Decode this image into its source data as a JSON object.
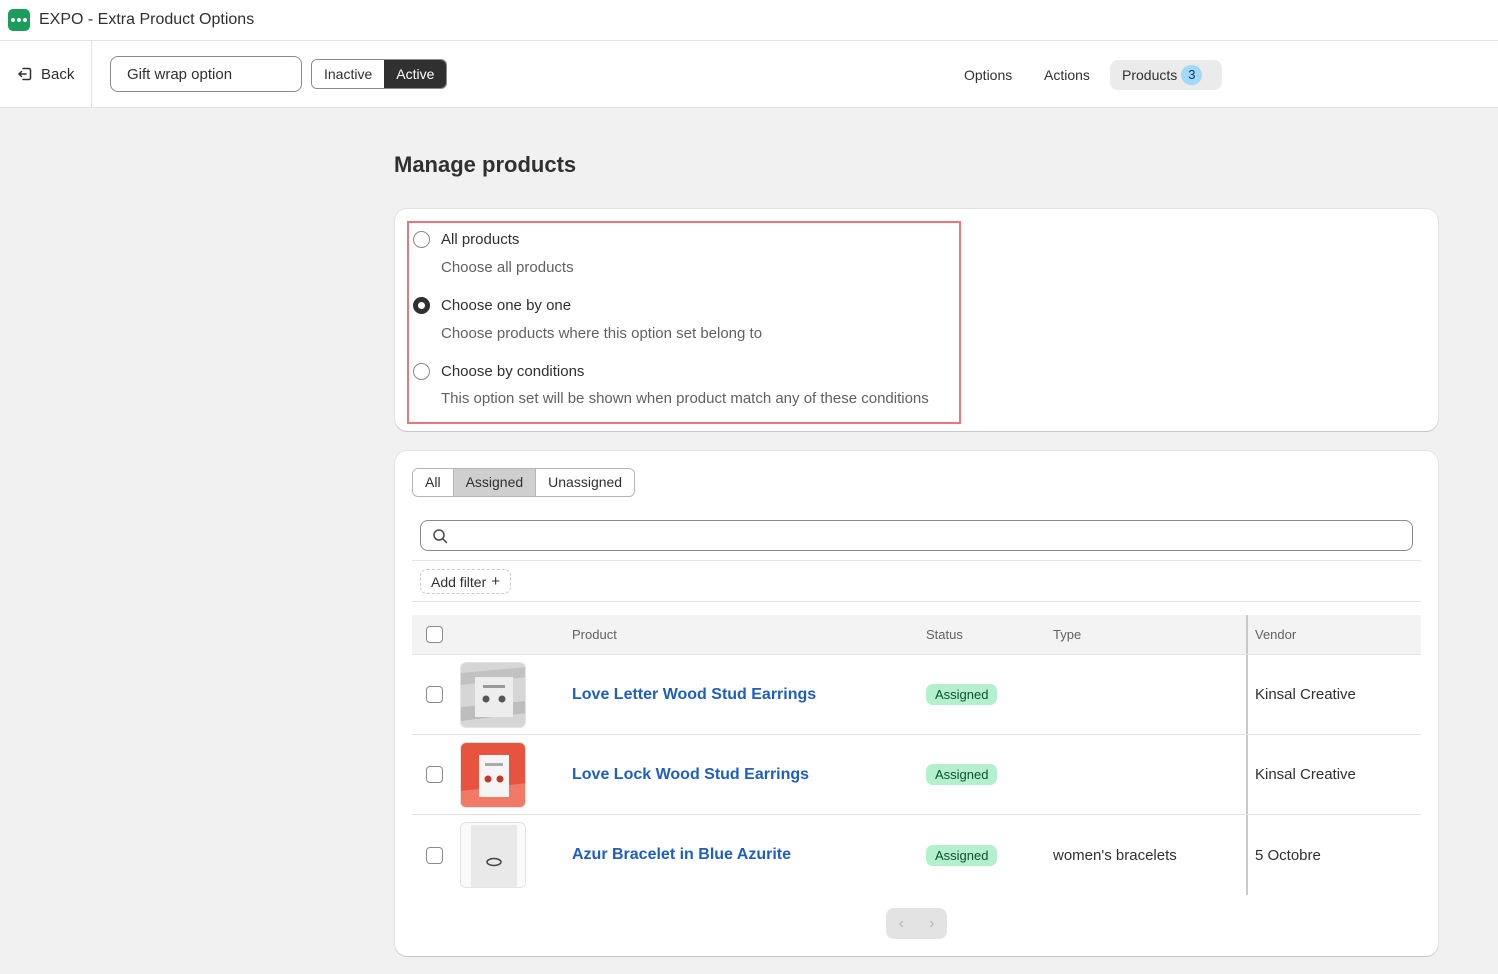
{
  "app": {
    "title": "EXPO - Extra Product Options"
  },
  "header": {
    "back_label": "Back",
    "option_name": "Gift wrap option",
    "status_options": [
      "Inactive",
      "Active"
    ],
    "status_selected": "Active",
    "nav": {
      "options": "Options",
      "actions": "Actions",
      "products": "Products",
      "products_count": "3"
    }
  },
  "page": {
    "title": "Manage products"
  },
  "selection": {
    "options": [
      {
        "label": "All products",
        "help": "Choose all products",
        "checked": false
      },
      {
        "label": "Choose one by one",
        "help": "Choose products where this option set belong to",
        "checked": true
      },
      {
        "label": "Choose by conditions",
        "help": "This option set will be shown when product match any of these conditions",
        "checked": false
      }
    ]
  },
  "filters": {
    "tabs": [
      "All",
      "Assigned",
      "Unassigned"
    ],
    "selected_tab": "Assigned",
    "search_placeholder": "",
    "add_filter_label": "Add filter",
    "add_filter_icon": "+"
  },
  "table": {
    "columns": {
      "product": "Product",
      "status": "Status",
      "type": "Type",
      "vendor": "Vendor"
    },
    "rows": [
      {
        "product": "Love Letter Wood Stud Earrings",
        "status": "Assigned",
        "type": "",
        "vendor": "Kinsal Creative",
        "thumb": "earrings-white-card"
      },
      {
        "product": "Love Lock Wood Stud Earrings",
        "status": "Assigned",
        "type": "",
        "vendor": "Kinsal Creative",
        "thumb": "earrings-red-card"
      },
      {
        "product": "Azur Bracelet in Blue Azurite",
        "status": "Assigned",
        "type": "women's bracelets",
        "vendor": "5 Octobre",
        "thumb": "bracelet"
      }
    ]
  },
  "pagination": {
    "prev_icon": "chevron-left-icon",
    "next_icon": "chevron-right-icon"
  },
  "colors": {
    "accent_dark": "#303030",
    "link": "#1f5dc2",
    "badge_bg": "#b4f0cd",
    "highlight": "#e8777c",
    "count_badge": "#a4d8fa",
    "brand": "#1a9c5b"
  }
}
